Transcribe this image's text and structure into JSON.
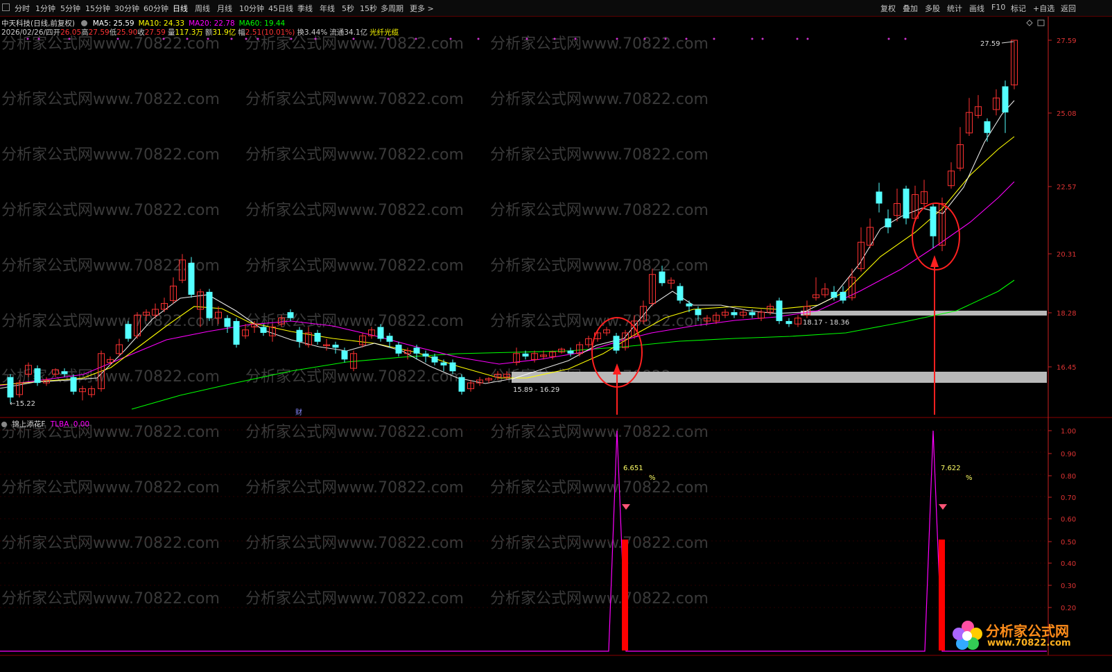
{
  "toolbar": {
    "periods": [
      "分时",
      "1分钟",
      "5分钟",
      "15分钟",
      "30分钟",
      "60分钟",
      "日线",
      "周线",
      "月线",
      "10分钟",
      "45日线",
      "季线",
      "年线",
      "5秒",
      "15秒",
      "多周期",
      "更多 >"
    ],
    "active_period": "日线",
    "right_items": [
      "复权",
      "叠加",
      "多股",
      "统计",
      "画线",
      "F10",
      "标记",
      "+自选",
      "返回"
    ]
  },
  "stock": {
    "title": "中天科技(日线,前复权)",
    "ma_legend": [
      {
        "label": "MA5: 25.59",
        "color": "#ffffff"
      },
      {
        "label": "MA10: 24.33",
        "color": "#ffff00"
      },
      {
        "label": "MA20: 22.78",
        "color": "#ff00ff"
      },
      {
        "label": "MA60: 19.44",
        "color": "#00ff00"
      }
    ],
    "quote_line": [
      {
        "text": "2026/02/26/四",
        "color": "#cccccc"
      },
      {
        "text": "开",
        "color": "#cccccc"
      },
      {
        "text": "26.05",
        "color": "#ff3333"
      },
      {
        "text": "高",
        "color": "#cccccc"
      },
      {
        "text": "27.59",
        "color": "#ff3333"
      },
      {
        "text": "低",
        "color": "#cccccc"
      },
      {
        "text": "25.90",
        "color": "#ff3333"
      },
      {
        "text": "收",
        "color": "#cccccc"
      },
      {
        "text": "27.59",
        "color": "#ff3333"
      },
      {
        "text": "量",
        "color": "#cccccc"
      },
      {
        "text": "117.3万",
        "color": "#ffff00"
      },
      {
        "text": "额",
        "color": "#cccccc"
      },
      {
        "text": "31.9亿",
        "color": "#ffff00"
      },
      {
        "text": "幅",
        "color": "#cccccc"
      },
      {
        "text": "2.51(10.01%)",
        "color": "#ff3333"
      },
      {
        "text": "换",
        "color": "#cccccc"
      },
      {
        "text": "3.44%",
        "color": "#cccccc"
      },
      {
        "text": "流通",
        "color": "#cccccc"
      },
      {
        "text": "34.1亿",
        "color": "#cccccc"
      },
      {
        "text": "光纤光缆",
        "color": "#ffff00"
      }
    ]
  },
  "price_axis": [
    "27.59",
    "25.08",
    "22.57",
    "20.31",
    "18.28",
    "16.45"
  ],
  "indicator_axis": [
    "1.00",
    "0.90",
    "0.80",
    "0.70",
    "0.60",
    "0.50",
    "0.40",
    "0.30",
    "0.20"
  ],
  "annotations": {
    "last_price": "27.59",
    "low_marker": "←15.22",
    "zone1": "15.89 - 16.29",
    "zone2": "18.17 - 18.36",
    "finance_mark": "财"
  },
  "indicator": {
    "title": "锦上添花F",
    "series": "TLBA",
    "value": "0.00",
    "signal1_pct": "6.651",
    "signal2_pct": "7.622",
    "pct_sign": "%"
  },
  "colors": {
    "up_candle": "#ff3232",
    "down_candle": "#54ffff",
    "ma5": "#ffffff",
    "ma10": "#ffff00",
    "ma20": "#ff00ff",
    "ma60": "#00ff00",
    "axis": "#cc2222",
    "zone": "#b9b9b9"
  },
  "watermark": "分析家公式网www.70822.com",
  "logo": {
    "name": "分析家公式网",
    "url": "www.70822.com"
  }
}
